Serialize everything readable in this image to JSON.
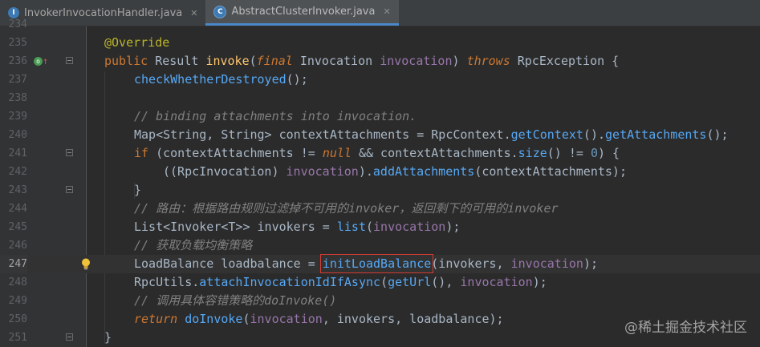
{
  "tabs": [
    {
      "label": "InvokerInvocationHandler.java",
      "icon": "interface-icon",
      "active": false
    },
    {
      "label": "AbstractClusterInvoker.java",
      "icon": "class-icon",
      "active": true
    }
  ],
  "lines": [
    {
      "num": "234"
    },
    {
      "num": "235"
    },
    {
      "num": "236"
    },
    {
      "num": "237"
    },
    {
      "num": "238"
    },
    {
      "num": "239"
    },
    {
      "num": "240"
    },
    {
      "num": "241"
    },
    {
      "num": "242"
    },
    {
      "num": "243"
    },
    {
      "num": "244"
    },
    {
      "num": "245"
    },
    {
      "num": "246"
    },
    {
      "num": "247"
    },
    {
      "num": "248"
    },
    {
      "num": "249"
    },
    {
      "num": "250"
    },
    {
      "num": "251"
    }
  ],
  "code": {
    "l235": {
      "ann": "@Override"
    },
    "l236": {
      "k1": "public",
      "t1": " Result ",
      "fn": "invoke",
      "p1": "(",
      "k2": "final",
      "t2": " Invocation ",
      "par": "invocation",
      "p2": ") ",
      "k3": "throws",
      "t3": " RpcException {"
    },
    "l237": {
      "c1": "checkWhetherDestroyed",
      "t1": "();"
    },
    "l239": {
      "cm": "// binding attachments into invocation."
    },
    "l240": {
      "t1": "Map<String, String> contextAttachments = RpcContext.",
      "c1": "getContext",
      "t2": "().",
      "c2": "getAttachments",
      "t3": "();"
    },
    "l241": {
      "k1": "if",
      "t1": " (contextAttachments != ",
      "k2": "null",
      "t2": " && contextAttachments.",
      "c1": "size",
      "t3": "() != ",
      "n1": "0",
      "t4": ") {"
    },
    "l242": {
      "t1": "((RpcInvocation) ",
      "par": "invocation",
      "t2": ").",
      "c1": "addAttachments",
      "t3": "(contextAttachments);"
    },
    "l243": {
      "t1": "}"
    },
    "l244": {
      "cm": "// 路由：根据路由规则过滤掉不可用的invoker，返回剩下的可用的invoker"
    },
    "l245": {
      "t1": "List<Invoker<T>> invokers = ",
      "c1": "list",
      "t2": "(",
      "par": "invocation",
      "t3": ");"
    },
    "l246": {
      "cm": "// 获取负载均衡策略"
    },
    "l247": {
      "t1": "LoadBalance loadbalance = ",
      "c1": "initLoadBalance",
      "t2": "(invokers, ",
      "par": "invocation",
      "t3": ");"
    },
    "l248": {
      "t1": "RpcUtils.",
      "c1": "attachInvocationIdIfAsync",
      "t2": "(",
      "c2": "getUrl",
      "t3": "(), ",
      "par": "invocation",
      "t4": ");"
    },
    "l249": {
      "cm": "// 调用具体容错策略的doInvoke()"
    },
    "l250": {
      "k1": "return",
      "t1": " ",
      "c1": "doInvoke",
      "t2": "(",
      "par": "invocation",
      "t3": ", invokers, loadbalance);"
    },
    "l251": {
      "t1": "}"
    }
  },
  "watermark": "@稀土掘金技术社区"
}
